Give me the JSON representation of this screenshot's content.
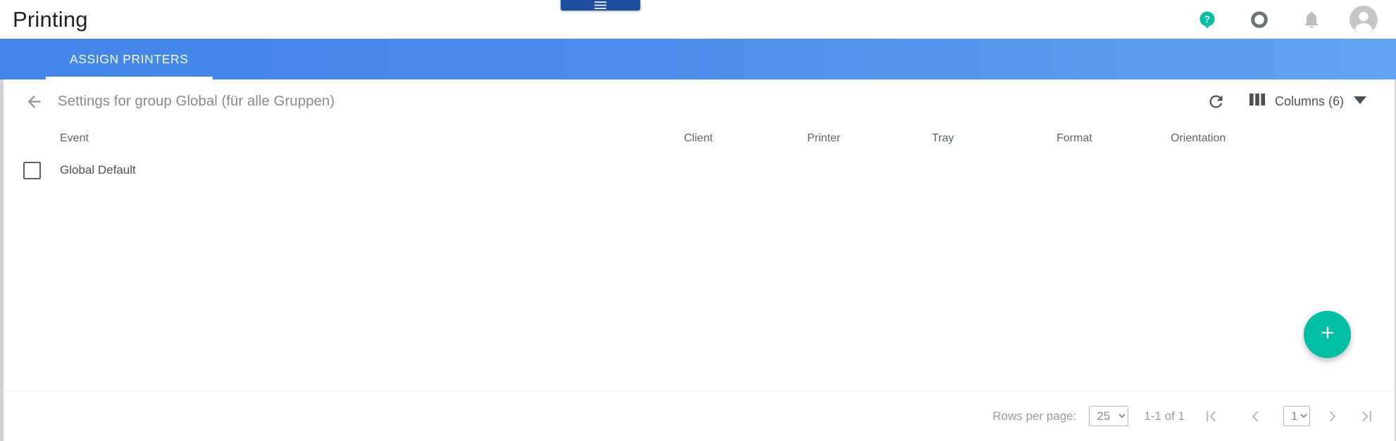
{
  "appbar": {
    "title": "Printing",
    "actions": [
      {
        "name": "help-icon",
        "label": "Help",
        "color": "#00bfa5"
      },
      {
        "name": "status-ring-icon",
        "label": "Status",
        "color": "#6b7378"
      },
      {
        "name": "notifications-bell-icon",
        "label": "Notifications",
        "color": "#bdbdbd"
      },
      {
        "name": "avatar",
        "label": "Account",
        "color": "#c6c6c6"
      }
    ],
    "menu_chip": {
      "label": "Menu",
      "icon": "hamburger-menu-icon",
      "color": "#1d4f9e"
    }
  },
  "tabs": {
    "items": [
      {
        "label": "ASSIGN PRINTERS",
        "active": true
      }
    ],
    "bar_color_start": "#4285ea",
    "bar_color_end": "#5fa3f2"
  },
  "card": {
    "back_label": "Back",
    "heading": "Settings for group Global (für alle Gruppen)",
    "refresh_label": "Refresh",
    "columns_label": "Columns (6)"
  },
  "table": {
    "columns": [
      "Event",
      "Client",
      "Printer",
      "Tray",
      "Format",
      "Orientation"
    ],
    "rows": [
      {
        "selected": false,
        "event": "Global Default",
        "client": "",
        "printer": "",
        "tray": "",
        "format": "",
        "orientation": ""
      }
    ]
  },
  "fab": {
    "label": "Add",
    "icon": "plus-icon",
    "color": "#00bfa5"
  },
  "paginator": {
    "rows_per_page_label": "Rows per page:",
    "rows_per_page_value": "25",
    "rows_per_page_options": [
      "25"
    ],
    "range_label": "1-1 of 1",
    "page_value": "1",
    "page_options": [
      "1"
    ],
    "first_label": "First page",
    "prev_label": "Previous page",
    "next_label": "Next page",
    "last_label": "Last page"
  }
}
